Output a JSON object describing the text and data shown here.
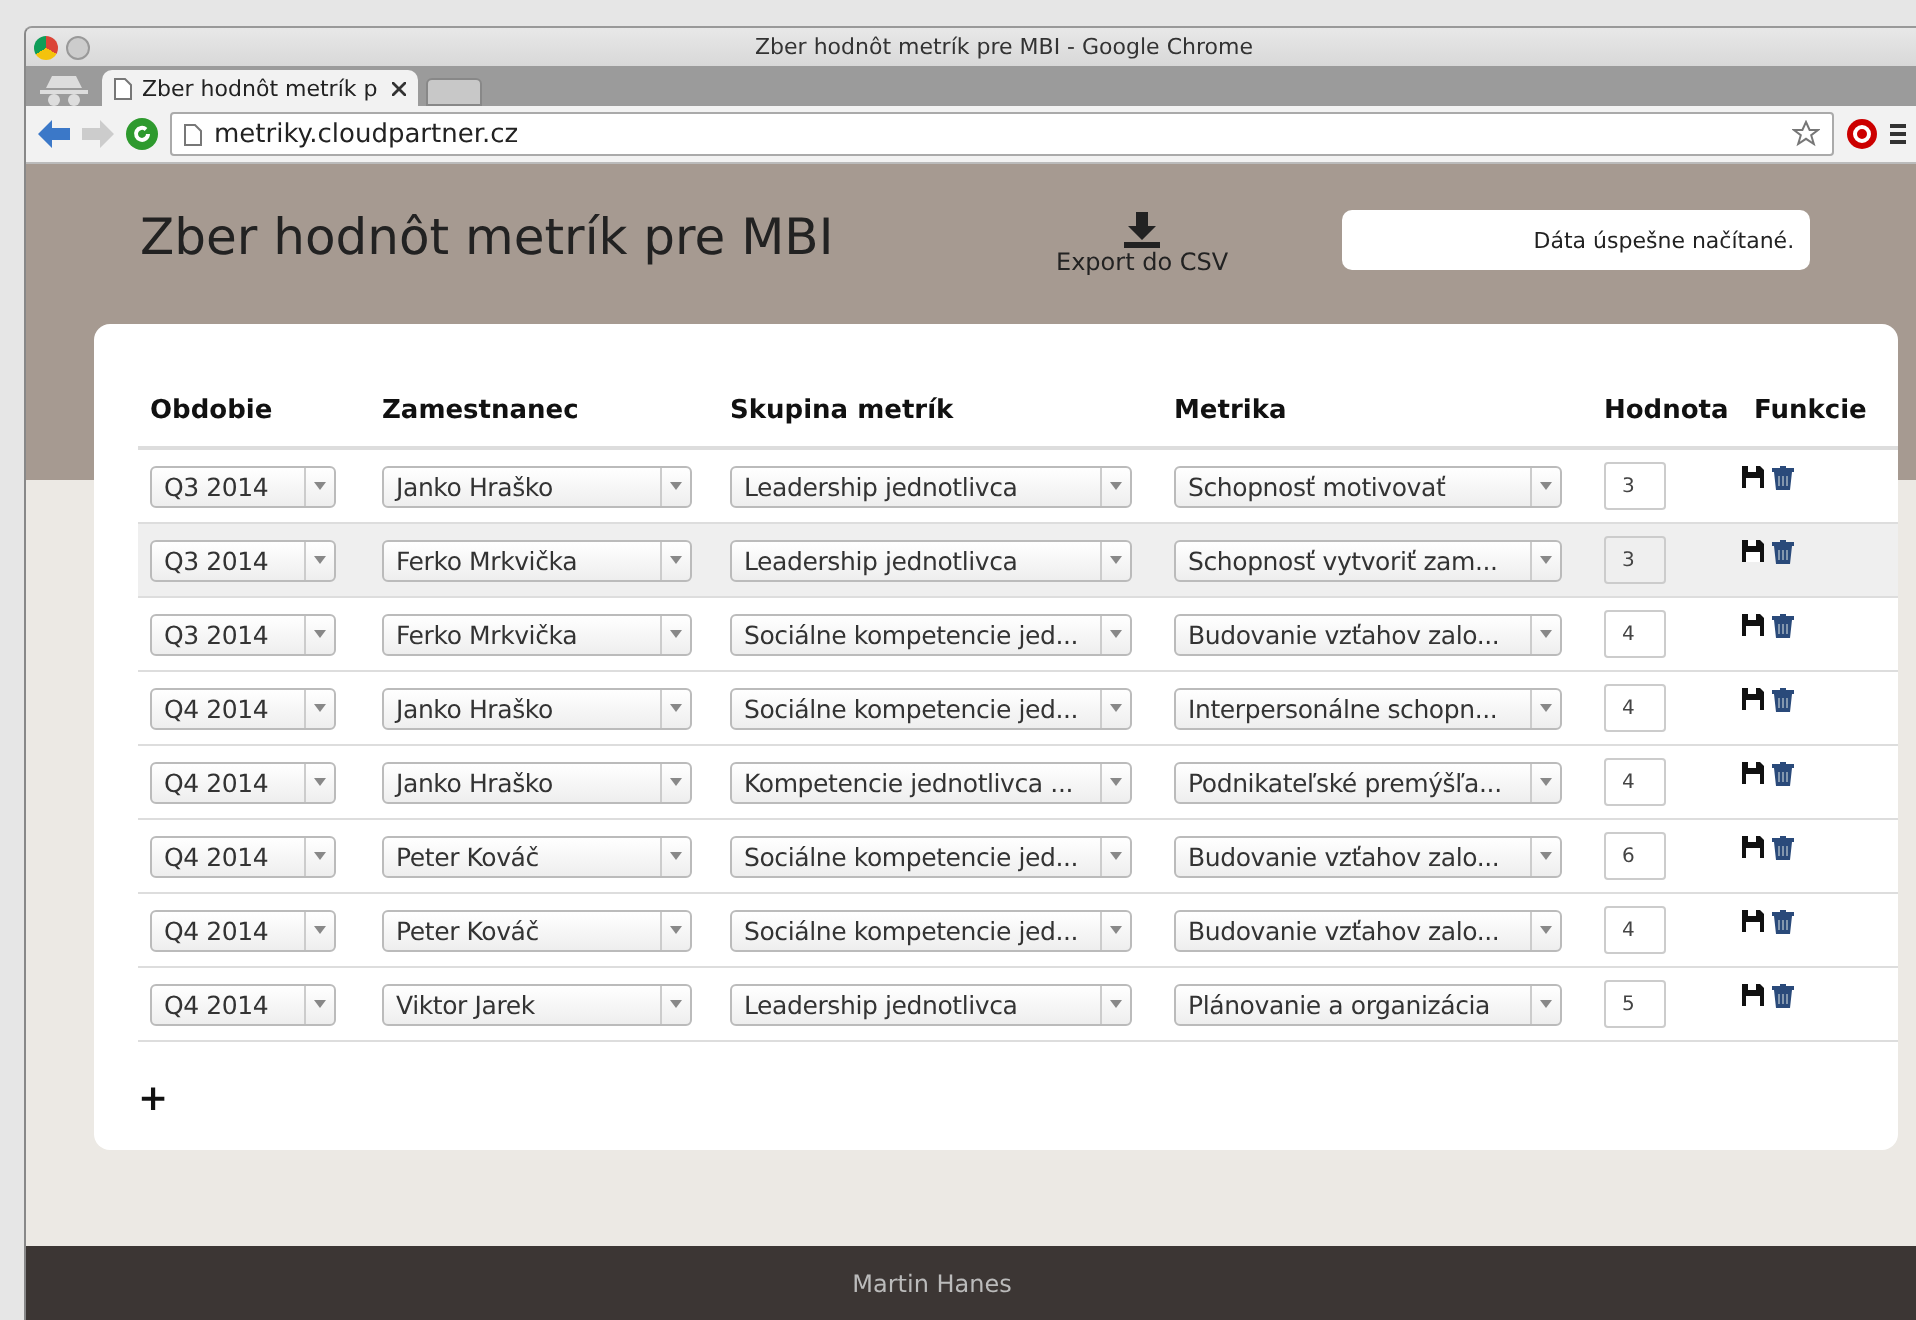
{
  "window": {
    "title": "Zber hodnôt metrík pre MBI - Google Chrome"
  },
  "tabs": [
    {
      "label": "Zber hodnôt metrík p",
      "selected": true
    }
  ],
  "address_bar": {
    "url": "metriky.cloudpartner.cz"
  },
  "page": {
    "title": "Zber hodnôt metrík pre MBI",
    "export_label": "Export do CSV",
    "status_message": "Dáta úspešne načítané."
  },
  "table": {
    "columns": [
      "Obdobie",
      "Zamestnanec",
      "Skupina metrík",
      "Metrika",
      "Hodnota",
      "Funkcie"
    ],
    "rows": [
      {
        "period": "Q3 2014",
        "employee": "Janko Hraško",
        "group": "Leadership jednotlivca",
        "metric": "Schopnosť motivovať",
        "value": "3",
        "highlighted": false
      },
      {
        "period": "Q3 2014",
        "employee": "Ferko Mrkvička",
        "group": "Leadership jednotlivca",
        "metric": "Schopnosť vytvoriť zam...",
        "value": "3",
        "highlighted": true
      },
      {
        "period": "Q3 2014",
        "employee": "Ferko Mrkvička",
        "group": "Sociálne kompetencie jed...",
        "metric": "Budovanie vzťahov zalo...",
        "value": "4",
        "highlighted": false
      },
      {
        "period": "Q4 2014",
        "employee": "Janko Hraško",
        "group": "Sociálne kompetencie jed...",
        "metric": "Interpersonálne schopn...",
        "value": "4",
        "highlighted": false
      },
      {
        "period": "Q4 2014",
        "employee": "Janko Hraško",
        "group": "Kompetencie jednotlivca ...",
        "metric": "Podnikateľské premýšľa...",
        "value": "4",
        "highlighted": false
      },
      {
        "period": "Q4 2014",
        "employee": "Peter Kováč",
        "group": "Sociálne kompetencie jed...",
        "metric": "Budovanie vzťahov zalo...",
        "value": "6",
        "highlighted": false
      },
      {
        "period": "Q4 2014",
        "employee": "Peter Kováč",
        "group": "Sociálne kompetencie jed...",
        "metric": "Budovanie vzťahov zalo...",
        "value": "4",
        "highlighted": false
      },
      {
        "period": "Q4 2014",
        "employee": "Viktor Jarek",
        "group": "Leadership jednotlivca",
        "metric": "Plánovanie a organizácia",
        "value": "5",
        "highlighted": false
      }
    ],
    "add_label": "+"
  },
  "footer": {
    "text": "Martin Hanes"
  }
}
